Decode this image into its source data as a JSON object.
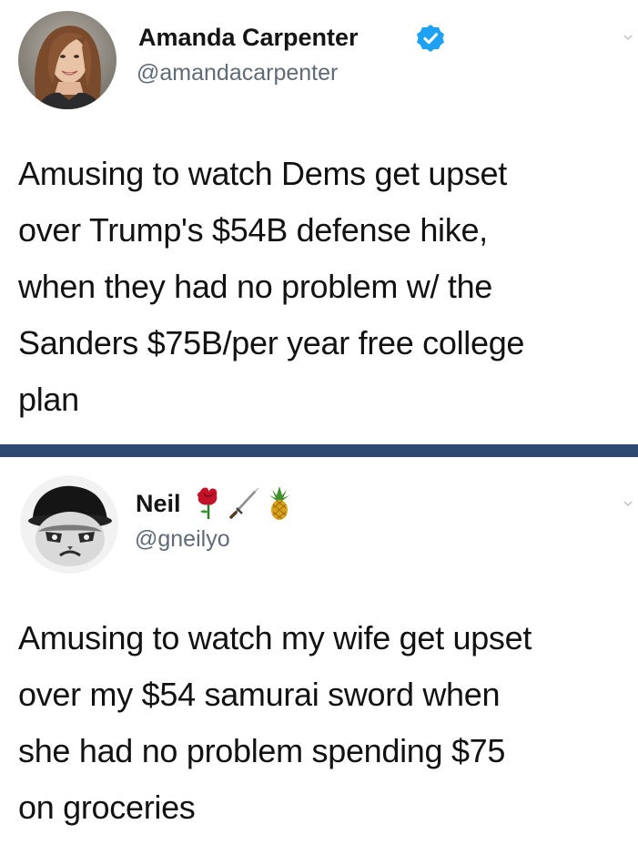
{
  "tweets": [
    {
      "display_name": "Amanda Carpenter",
      "handle": "@amandacarpenter",
      "verified": true,
      "avatar_icon": "woman-portrait-avatar",
      "text_lines": [
        "Amusing to watch Dems get upset",
        "over Trump's $54B defense hike,",
        "when they had no problem w/ the",
        "Sanders $75B/per year free college",
        "plan"
      ]
    },
    {
      "display_name": "Neil",
      "handle": "@gneilyo",
      "verified": false,
      "avatar_icon": "grumpy-cat-avatar",
      "name_emojis": [
        "rose-icon",
        "sword-icon",
        "pineapple-icon"
      ],
      "text_lines": [
        "Amusing to watch my wife get upset",
        "over my $54 samurai sword when",
        "she had no problem spending $75",
        "on groceries"
      ]
    }
  ],
  "colors": {
    "divider_band": "#2d4a73",
    "verified_badge": "#1da1f2",
    "handle_text": "#5f6b77"
  }
}
